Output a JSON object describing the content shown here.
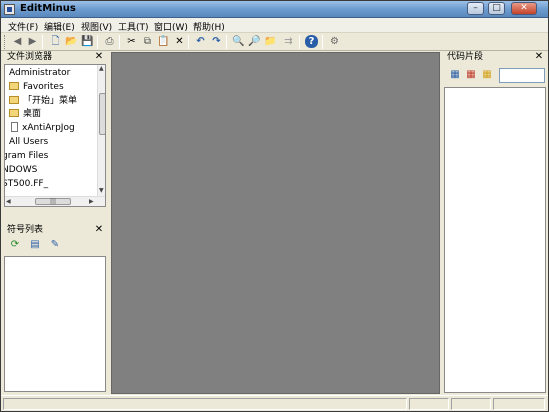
{
  "window": {
    "title": "EditMinus",
    "controls": {
      "minimize": "–",
      "maximize": "□",
      "close": "✕"
    }
  },
  "menu": [
    "文件(F)",
    "编辑(E)",
    "视图(V)",
    "工具(T)",
    "窗口(W)",
    "帮助(H)"
  ],
  "toolbar": {
    "buttons": [
      {
        "name": "back-icon",
        "glyph": "◀"
      },
      {
        "name": "forward-icon",
        "glyph": "▶"
      },
      {
        "name": "new-file-icon",
        "glyph": "🗋"
      },
      {
        "name": "open-file-icon",
        "glyph": "📂"
      },
      {
        "name": "save-icon",
        "glyph": "💾"
      },
      {
        "name": "print-icon",
        "glyph": "⎙"
      },
      {
        "name": "cut-icon",
        "glyph": "✂"
      },
      {
        "name": "copy-icon",
        "glyph": "⧉"
      },
      {
        "name": "paste-icon",
        "glyph": "📋"
      },
      {
        "name": "delete-icon",
        "glyph": "✕"
      },
      {
        "name": "undo-icon",
        "glyph": "↶"
      },
      {
        "name": "redo-icon",
        "glyph": "↷"
      },
      {
        "name": "find-icon",
        "glyph": "🔍"
      },
      {
        "name": "replace-icon",
        "glyph": "🔎"
      },
      {
        "name": "folder-search-icon",
        "glyph": "📁"
      },
      {
        "name": "goto-icon",
        "glyph": "⇉"
      },
      {
        "name": "help-icon",
        "glyph": "?"
      },
      {
        "name": "settings-icon",
        "glyph": "⚙"
      }
    ]
  },
  "file_browser": {
    "title": "文件浏览器",
    "close": "✕",
    "items": [
      {
        "label": "Administrator",
        "icon": "none"
      },
      {
        "label": "Favorites",
        "icon": "folder"
      },
      {
        "label": "「开始」菜单",
        "icon": "folder"
      },
      {
        "label": "桌面",
        "icon": "folder"
      },
      {
        "label": "xAntiArpJog",
        "icon": "file"
      },
      {
        "label": "All Users",
        "icon": "none"
      },
      {
        "label": "gram Files",
        "icon": "none"
      },
      {
        "label": "NDOWS",
        "icon": "none"
      },
      {
        "label": "ST500.FF_",
        "icon": "none"
      }
    ]
  },
  "symbol_list": {
    "title": "符号列表",
    "close": "✕"
  },
  "snippets": {
    "title": "代码片段",
    "close": "✕",
    "combo_value": ""
  },
  "colors": {
    "editor_bg": "#808080",
    "title_gradient_top": "#9dc0e6",
    "title_gradient_bottom": "#5a88bd"
  }
}
